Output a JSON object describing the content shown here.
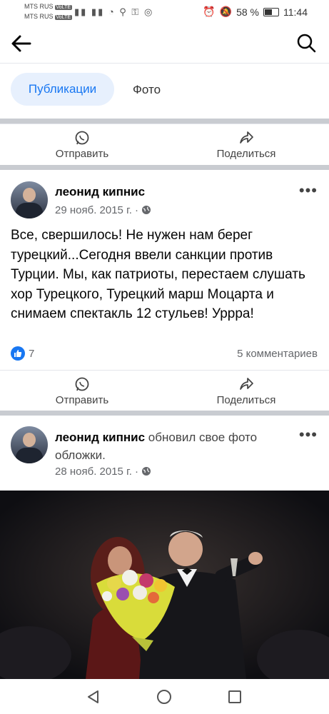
{
  "status_bar": {
    "carrier1": "MTS RUS",
    "carrier2": "MTS RUS",
    "carrier_tag": "VoLTE",
    "battery": "58 %",
    "time": "11:44"
  },
  "tabs": {
    "active": "Публикации",
    "photo": "Фото"
  },
  "actions": {
    "send": "Отправить",
    "share": "Поделиться"
  },
  "post1": {
    "author": "леонид кипнис",
    "date": "29 нояб. 2015 г. ·",
    "text": "Все, свершилось!  Не нужен нам берег турецкий...Сегодня ввели санкции против Турции. Мы, как патриоты, перестаем слушать хор Турецкого, Турецкий марш Моцарта и снимаем спектакль 12 стульев! Урррa!",
    "likes": "7",
    "comments": "5 комментариев"
  },
  "post2": {
    "author": "леонид кипнис",
    "action": " обновил свое фото обложки.",
    "date": "28 нояб. 2015 г. ·"
  },
  "more": "•••",
  "colors": {
    "accent": "#1877f2",
    "separator": "#c9ccd1"
  }
}
